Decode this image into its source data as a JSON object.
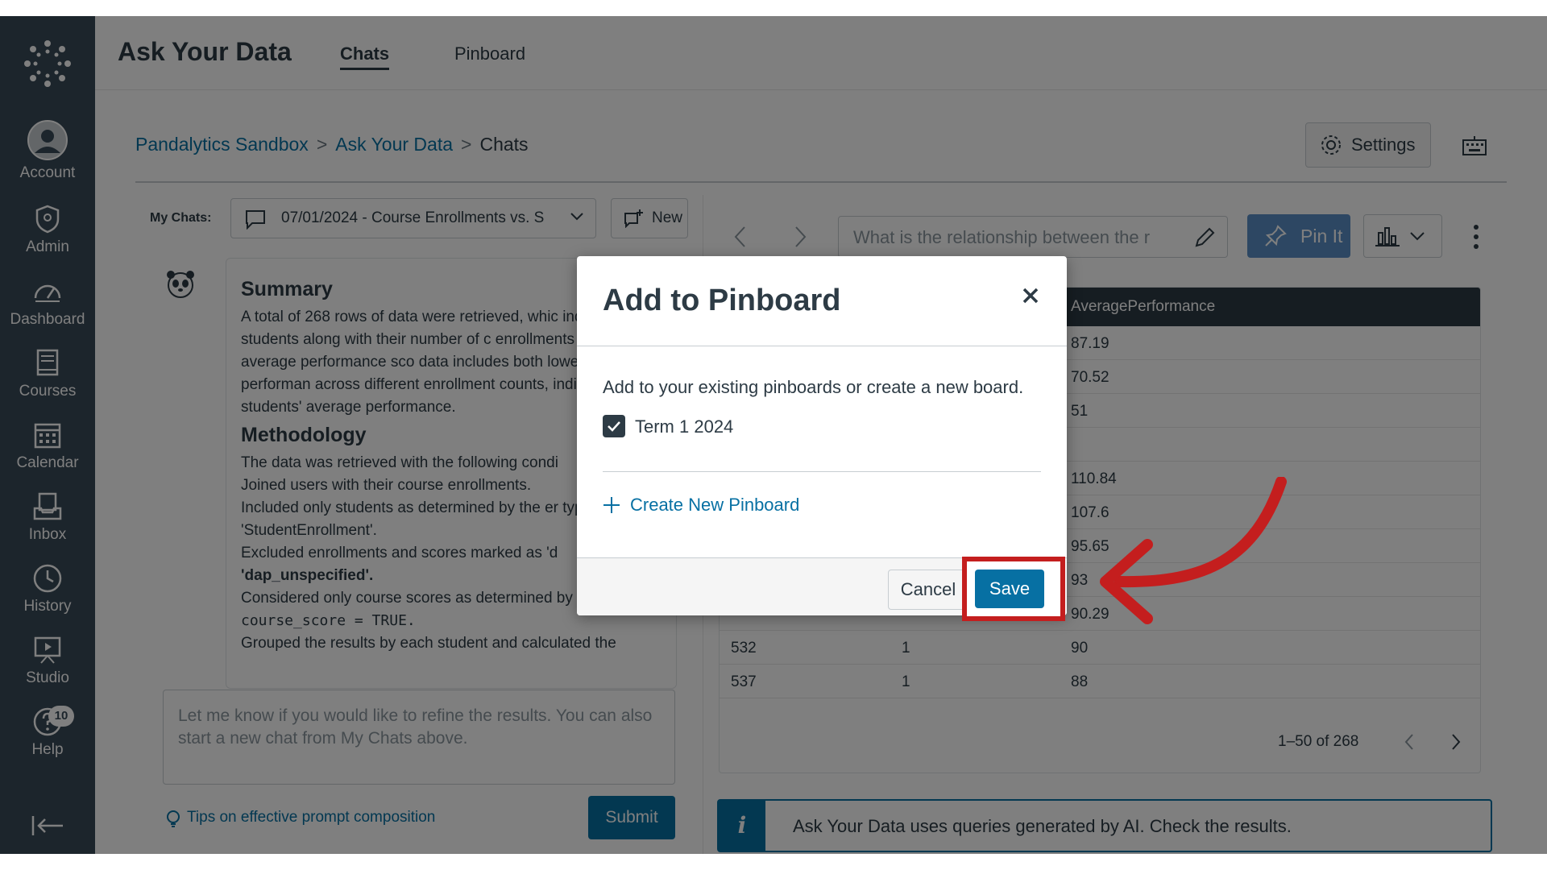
{
  "sidebar": {
    "items": [
      {
        "label": "Account",
        "icon": "account-icon"
      },
      {
        "label": "Admin",
        "icon": "shield-icon"
      },
      {
        "label": "Dashboard",
        "icon": "dashboard-icon"
      },
      {
        "label": "Courses",
        "icon": "book-icon"
      },
      {
        "label": "Calendar",
        "icon": "calendar-icon"
      },
      {
        "label": "Inbox",
        "icon": "inbox-icon"
      },
      {
        "label": "History",
        "icon": "clock-icon"
      },
      {
        "label": "Studio",
        "icon": "studio-icon"
      },
      {
        "label": "Help",
        "icon": "help-icon",
        "badge": "10"
      }
    ]
  },
  "header": {
    "title": "Ask Your Data",
    "tabs": [
      {
        "label": "Chats",
        "active": true
      },
      {
        "label": "Pinboard",
        "active": false
      }
    ]
  },
  "breadcrumb": {
    "items": [
      "Pandalytics Sandbox",
      "Ask Your Data",
      "Chats"
    ],
    "separator": ">"
  },
  "toolbar": {
    "settings_label": "Settings"
  },
  "chat": {
    "my_chats_label": "My Chats:",
    "selected_chat": "07/01/2024 - Course Enrollments vs. S",
    "new_label": "New",
    "summary_heading": "Summary",
    "summary_text": "A total of 268 rows of data were retrieved, whic individual students along with their number of c enrollments and their average performance sco data includes both lower and higher performan across different enrollment counts, indicating a in students' average performance.",
    "methodology_heading": "Methodology",
    "methodology_lines": [
      "The data was retrieved with the following condi",
      "Joined users with their course enrollments.",
      "Included only students as determined by the er type 'StudentEnrollment'.",
      "Excluded enrollments and scores marked as 'd",
      "'dap_unspecified'.",
      "Considered only course scores as determined by the flag",
      "course_score = TRUE.",
      "Grouped the results by each student and calculated the"
    ],
    "prompt_placeholder": "Let me know if you would like to refine the results.  You can also start a new chat from My Chats above.",
    "tips_label": "Tips on effective prompt composition",
    "submit_label": "Submit"
  },
  "results": {
    "query_placeholder": "What is the relationship between the r",
    "pin_label": "Pin It",
    "table": {
      "header": [
        "",
        "",
        "AveragePerformance"
      ],
      "rows": [
        [
          "",
          "",
          "87.19"
        ],
        [
          "",
          "",
          "70.52"
        ],
        [
          "",
          "",
          "51"
        ],
        [
          "",
          "",
          ""
        ],
        [
          "",
          "",
          "110.84"
        ],
        [
          "",
          "",
          "107.6"
        ],
        [
          "",
          "",
          "95.65"
        ],
        [
          "",
          "",
          "93"
        ],
        [
          "",
          "",
          "90.29"
        ],
        [
          "532",
          "1",
          "90"
        ],
        [
          "537",
          "1",
          "88"
        ]
      ]
    },
    "pagination": "1–50 of 268",
    "info_text": "Ask Your Data uses queries generated by AI. Check the results."
  },
  "modal": {
    "title": "Add to Pinboard",
    "description": "Add to your existing pinboards or create a new board.",
    "pinboards": [
      {
        "label": "Term 1 2024",
        "checked": true
      }
    ],
    "create_label": "Create New Pinboard",
    "cancel_label": "Cancel",
    "save_label": "Save"
  },
  "colors": {
    "sidebar_bg": "#394b58",
    "brand_blue": "#0770a3",
    "highlight_red": "#c41e1e"
  }
}
